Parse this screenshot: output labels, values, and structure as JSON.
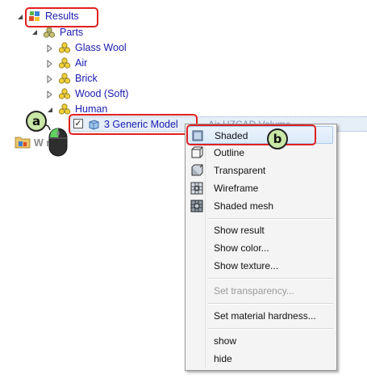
{
  "tree": {
    "results_label": "Results",
    "parts_label": "Parts",
    "items": [
      {
        "label": "Glass Wool"
      },
      {
        "label": "Air"
      },
      {
        "label": "Brick"
      },
      {
        "label": "Wood (Soft)"
      },
      {
        "label": "Human"
      }
    ],
    "selected_item": {
      "label": "3 Generic Model",
      "checked": true,
      "obscured_suffix": "Air  HZCAD Volume"
    },
    "partial_item_label": "W     r"
  },
  "callouts": {
    "a": "a",
    "b": "b"
  },
  "context_menu": {
    "items": [
      {
        "label": "Shaded",
        "icon": "shaded-cube-icon",
        "highlighted": true
      },
      {
        "label": "Outline",
        "icon": "outline-cube-icon"
      },
      {
        "label": "Transparent",
        "icon": "transparent-cube-icon"
      },
      {
        "label": "Wireframe",
        "icon": "wireframe-icon"
      },
      {
        "label": "Shaded mesh",
        "icon": "shaded-mesh-icon"
      },
      {
        "label": "Show result"
      },
      {
        "label": "Show color..."
      },
      {
        "label": "Show texture..."
      },
      {
        "label": "Set transparency...",
        "disabled": true
      },
      {
        "label": "Set material hardness..."
      },
      {
        "label": "show"
      },
      {
        "label": "hide"
      }
    ]
  },
  "colors": {
    "callout_red": "#e0211f",
    "tree_text": "#1a1ab0",
    "badge_fill": "#c9e7a6"
  }
}
